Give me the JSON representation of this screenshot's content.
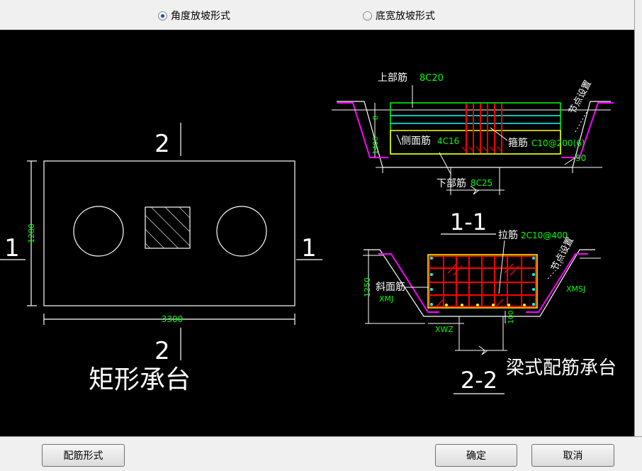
{
  "slope_options": {
    "angle": {
      "label": "角度放坡形式",
      "selected": true
    },
    "width": {
      "label": "底宽放坡形式",
      "selected": false
    }
  },
  "plan": {
    "cut_top": "2",
    "cut_bottom": "2",
    "cut_left": "1",
    "cut_right": "1",
    "height_dim": "1200",
    "width_dim": "3300",
    "caption": "矩形承台"
  },
  "section_1": {
    "top_bar_label": "上部筋",
    "top_bar_value": "8C20",
    "node_label": "节点设置",
    "dim_zero": "0",
    "dim_height": "1400",
    "side_bar_label": "侧面筋",
    "side_bar_value": "4C16",
    "stirrup_label": "箍筋",
    "stirrup_value": "C10@200(6)",
    "angle_value": "90",
    "bottom_bar_label": "下部筋",
    "bottom_bar_value": "8C25",
    "title": "1-1"
  },
  "section_2": {
    "tie_label": "拉筋",
    "tie_value": "2C10@400",
    "node_label": "节点设置",
    "height_dim": "1250",
    "slope_bar_label": "斜面筋",
    "xmj": "XMJ",
    "xmsj": "XMSJ",
    "xwz": "XWZ",
    "dim_100": "100",
    "title": "2-2",
    "caption": "梁式配筋承台"
  },
  "buttons": {
    "rebar_form": "配筋形式",
    "ok": "确定",
    "cancel": "取消"
  },
  "colors": {
    "canvas_bg": "#000000",
    "drawing_white": "#ffffff",
    "annotation_green": "#00ff00",
    "rebar_red": "#ff0000",
    "rebar_cyan": "#00ffff",
    "outline_yellow": "#ffff00",
    "slope_magenta": "#ff00ff"
  }
}
